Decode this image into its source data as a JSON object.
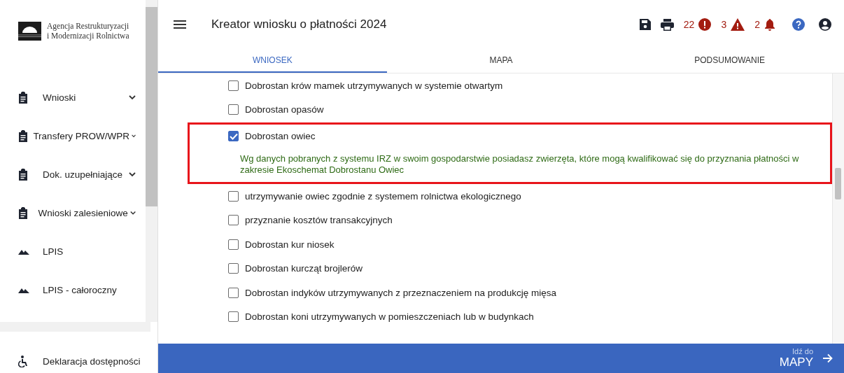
{
  "sidebar": {
    "logo_lines": [
      "Agencja Restrukturyzacji",
      "i Modernizacji Rolnictwa"
    ],
    "items": [
      {
        "label": "Wnioski",
        "kind": "clipboard",
        "expandable": true
      },
      {
        "label": "Transfery PROW/WPR",
        "kind": "clipboard",
        "expandable": true
      },
      {
        "label": "Dok. uzupełniające",
        "kind": "clipboard",
        "expandable": true
      },
      {
        "label": "Wnioski zalesieniowe",
        "kind": "clipboard",
        "expandable": true
      },
      {
        "label": "LPIS",
        "kind": "terrain",
        "expandable": false
      },
      {
        "label": "LPIS - całoroczny",
        "kind": "terrain",
        "expandable": false
      }
    ],
    "footer_item": {
      "label": "Deklaracja dostępności",
      "kind": "accessibility"
    }
  },
  "header": {
    "title": "Kreator wniosku o płatności 2024",
    "counters": [
      {
        "count": "22",
        "kind": "error"
      },
      {
        "count": "3",
        "kind": "warning"
      },
      {
        "count": "2",
        "kind": "notification"
      }
    ]
  },
  "tabs": [
    {
      "label": "WNIOSEK",
      "selected": true
    },
    {
      "label": "MAPA",
      "selected": false
    },
    {
      "label": "PODSUMOWANIE",
      "selected": false
    }
  ],
  "options": [
    {
      "label": "Dobrostan krów mamek utrzymywanych w systemie otwartym",
      "checked": false
    },
    {
      "label": "Dobrostan opasów",
      "checked": false
    },
    {
      "label": "Dobrostan owiec",
      "checked": true,
      "highlighted": true,
      "note": "Wg danych pobranych z systemu IRZ w swoim gospodarstwie posiadasz zwierzęta, które mogą kwalifikować się do przyznania płatności w zakresie Ekoschemat Dobrostanu Owiec",
      "children": [
        {
          "label": "utrzymywanie owiec zgodnie z systemem rolnictwa ekologicznego",
          "checked": false
        },
        {
          "label": "przyznanie kosztów transakcyjnych",
          "checked": false
        }
      ]
    },
    {
      "label": "Dobrostan kur niosek",
      "checked": false
    },
    {
      "label": "Dobrostan kurcząt brojlerów",
      "checked": false
    },
    {
      "label": "Dobrostan indyków utrzymywanych z przeznaczeniem na produkcję mięsa",
      "checked": false
    },
    {
      "label": "Dobrostan koni utrzymywanych w pomieszczeniach lub w budynkach",
      "checked": false
    }
  ],
  "next_button": {
    "caption": "Idź do",
    "label": "MAPY"
  }
}
